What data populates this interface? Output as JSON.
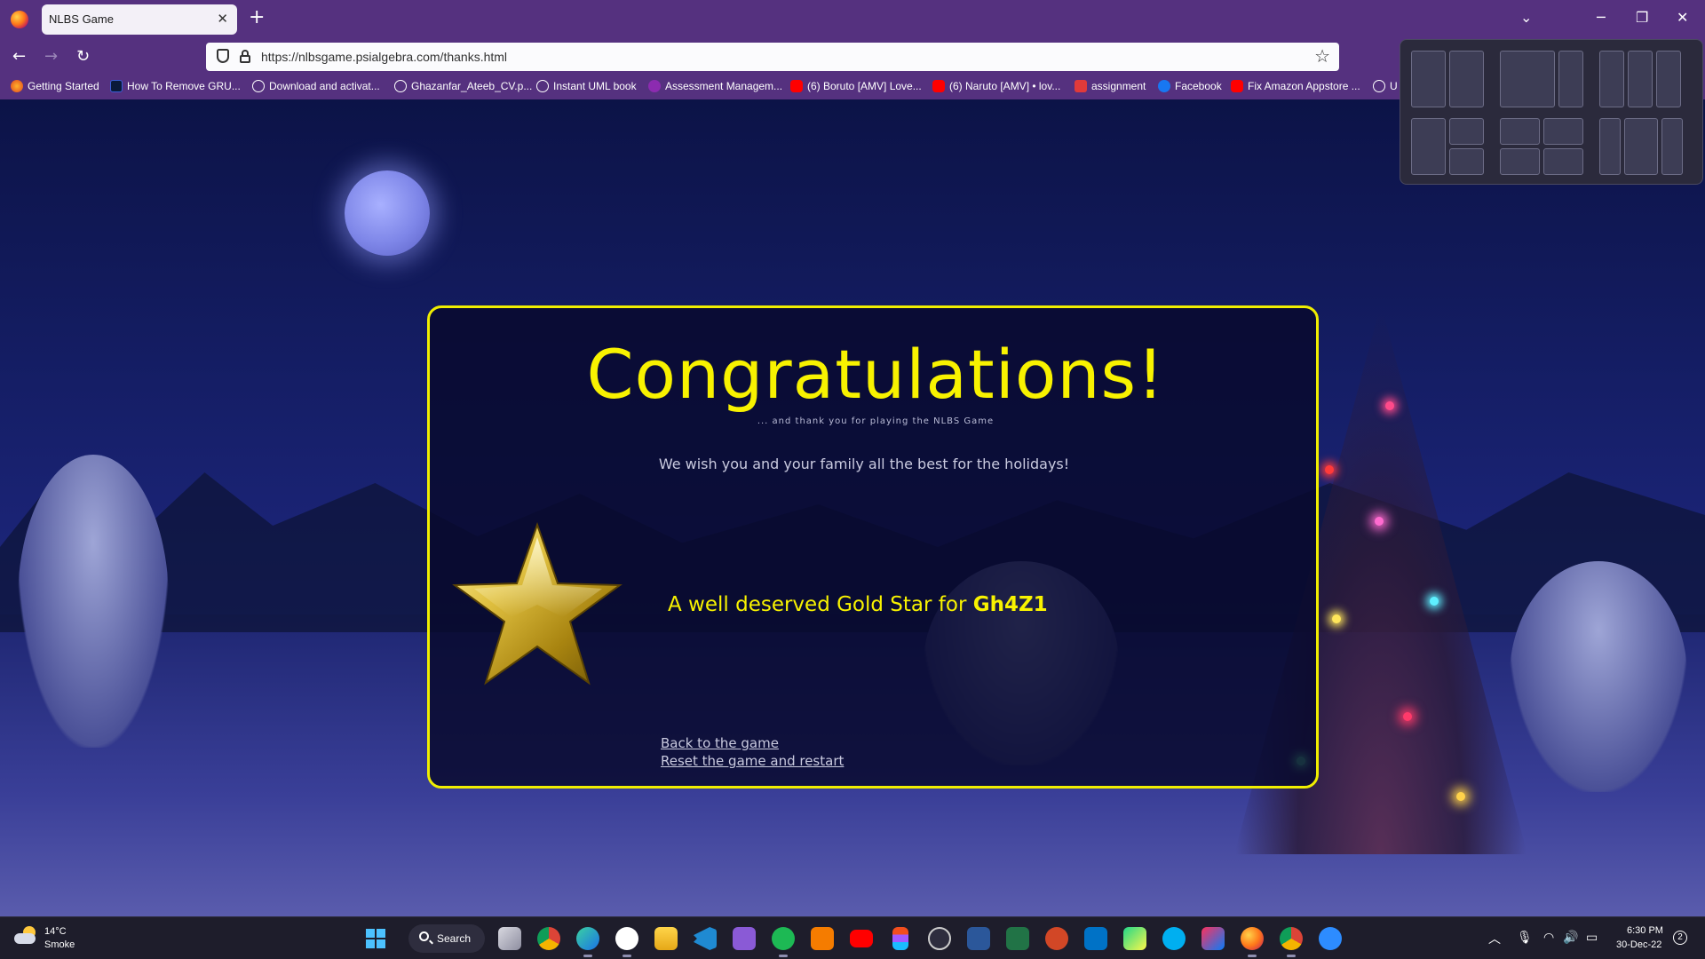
{
  "browser": {
    "tab_title": "NLBS Game",
    "url": "https://nlbsgame.psialgebra.com/thanks.html",
    "bookmarks": [
      {
        "label": "Getting Started",
        "icon": "firefox-icon"
      },
      {
        "label": "How To Remove GRU...",
        "icon": "site-icon"
      },
      {
        "label": "Download and activat...",
        "icon": "globe-icon"
      },
      {
        "label": "Ghazanfar_Ateeb_CV.p...",
        "icon": "globe-icon"
      },
      {
        "label": "Instant UML book",
        "icon": "globe-icon"
      },
      {
        "label": "Assessment Managem...",
        "icon": "site-icon"
      },
      {
        "label": "(6) Boruto [AMV] Love...",
        "icon": "youtube-icon"
      },
      {
        "label": "(6) Naruto [AMV] • lov...",
        "icon": "youtube-icon"
      },
      {
        "label": "assignment",
        "icon": "site-icon"
      },
      {
        "label": "Facebook",
        "icon": "facebook-icon"
      },
      {
        "label": "Fix Amazon Appstore ...",
        "icon": "youtube-icon"
      },
      {
        "label": "U",
        "icon": "globe-icon"
      }
    ]
  },
  "card": {
    "title": "Congratulations!",
    "subtitle": "... and thank you for playing the NLBS Game",
    "wish": "We wish you and your family all the best for the holidays!",
    "star_text": "A well deserved Gold Star for ",
    "player_name": "Gh4Z1",
    "links": {
      "back": "Back to the game",
      "reset": "Reset the game and restart"
    }
  },
  "taskbar": {
    "temperature": "14°C",
    "condition": "Smoke",
    "search_label": "Search",
    "time": "6:30 PM",
    "date": "30-Dec-22",
    "notification_count": "2"
  },
  "colors": {
    "chrome": "#55317f",
    "card_border": "#f0ee00",
    "title": "#f8f200",
    "taskbar": "#1e1d2b"
  }
}
